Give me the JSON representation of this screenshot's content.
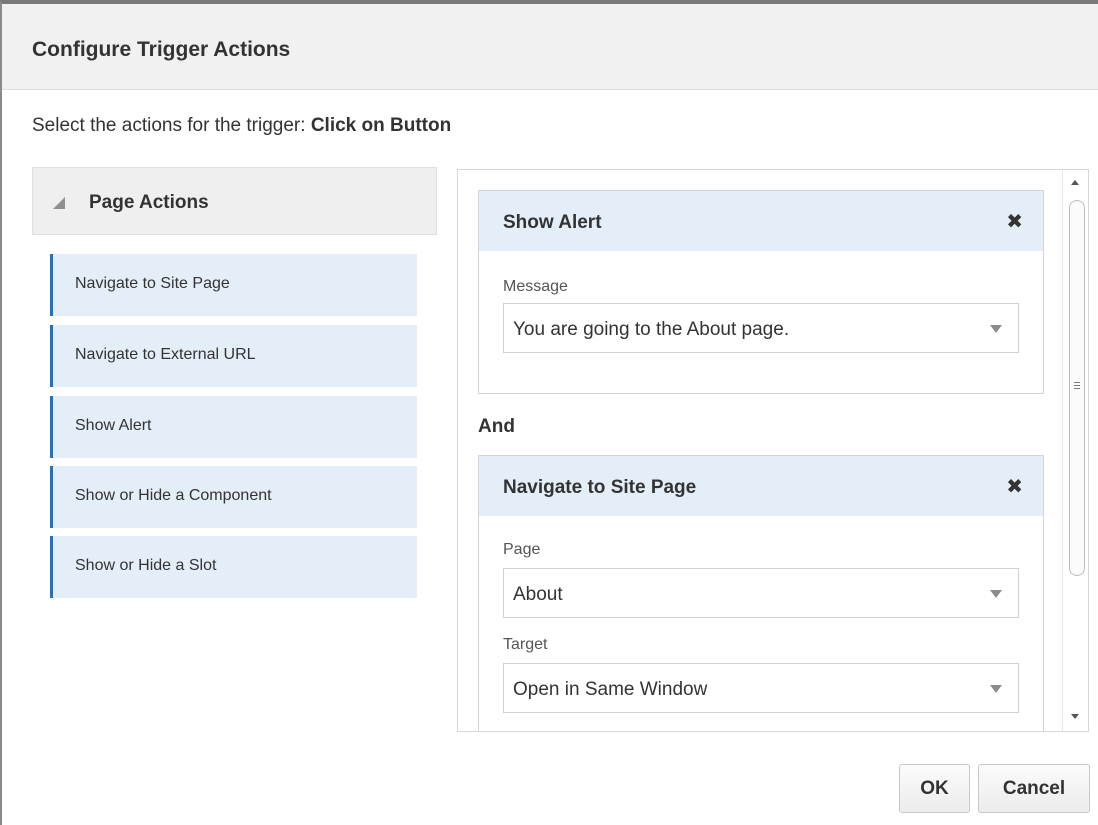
{
  "dialog": {
    "title": "Configure Trigger Actions",
    "subtitle_prefix": "Select the actions for the trigger:",
    "trigger_name": "Click on Button"
  },
  "page_actions": {
    "header": "Page Actions",
    "items": [
      {
        "label": "Navigate to Site Page"
      },
      {
        "label": "Navigate to External URL"
      },
      {
        "label": "Show Alert"
      },
      {
        "label": "Show or Hide a Component"
      },
      {
        "label": "Show or Hide a Slot"
      }
    ]
  },
  "selected_actions": {
    "connector": "And",
    "show_alert": {
      "title": "Show Alert",
      "close_glyph": "✖",
      "message_label": "Message",
      "message_value": "You are going to the About page."
    },
    "navigate": {
      "title": "Navigate to Site Page",
      "close_glyph": "✖",
      "page_label": "Page",
      "page_value": "About",
      "target_label": "Target",
      "target_value": "Open in Same Window"
    }
  },
  "buttons": {
    "ok": "OK",
    "cancel": "Cancel"
  },
  "colors": {
    "accent": "#1f74c2",
    "item_bg": "#e3eef8",
    "header_bg": "#f1f1f1"
  }
}
